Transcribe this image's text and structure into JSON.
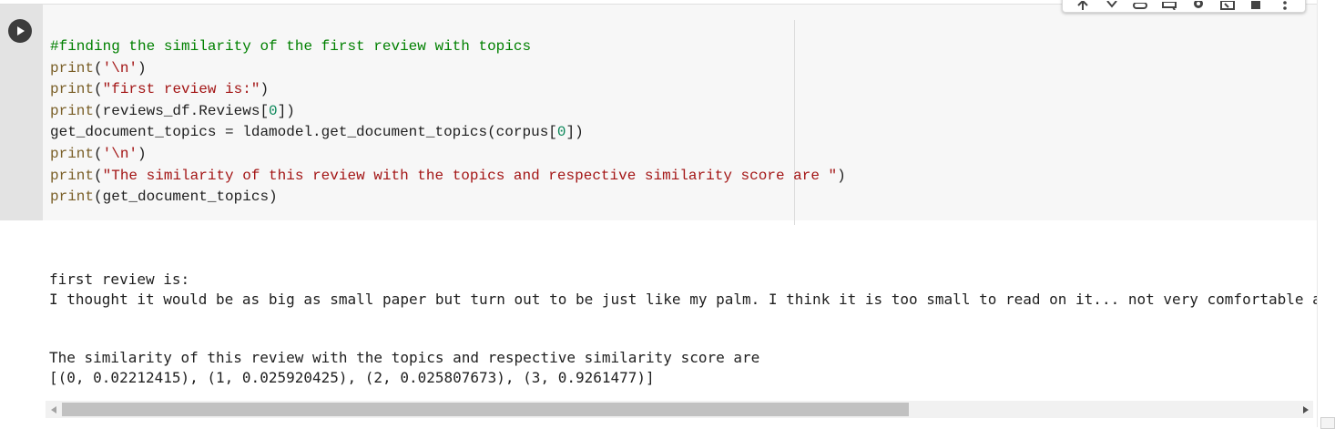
{
  "code_lines": [
    {
      "parts": [
        {
          "t": "#finding the similarity of the first review with topics",
          "c": "cm"
        }
      ]
    },
    {
      "parts": [
        {
          "t": "print",
          "c": "kw"
        },
        {
          "t": "(",
          "c": ""
        },
        {
          "t": "'\\n'",
          "c": "st"
        },
        {
          "t": ")",
          "c": ""
        }
      ]
    },
    {
      "parts": [
        {
          "t": "print",
          "c": "kw"
        },
        {
          "t": "(",
          "c": ""
        },
        {
          "t": "\"first review is:\"",
          "c": "st"
        },
        {
          "t": ")",
          "c": ""
        }
      ]
    },
    {
      "parts": [
        {
          "t": "print",
          "c": "kw"
        },
        {
          "t": "(reviews_df.Reviews[",
          "c": ""
        },
        {
          "t": "0",
          "c": "nm"
        },
        {
          "t": "])",
          "c": ""
        }
      ]
    },
    {
      "parts": [
        {
          "t": "get_document_topics = ldamodel.get_document_topics(corpus[",
          "c": ""
        },
        {
          "t": "0",
          "c": "nm"
        },
        {
          "t": "])",
          "c": ""
        }
      ]
    },
    {
      "parts": [
        {
          "t": "print",
          "c": "kw"
        },
        {
          "t": "(",
          "c": ""
        },
        {
          "t": "'\\n'",
          "c": "st"
        },
        {
          "t": ")",
          "c": ""
        }
      ]
    },
    {
      "parts": [
        {
          "t": "print",
          "c": "kw"
        },
        {
          "t": "(",
          "c": ""
        },
        {
          "t": "\"The similarity of this review with the topics and respective similarity score are \"",
          "c": "st"
        },
        {
          "t": ")",
          "c": ""
        }
      ]
    },
    {
      "parts": [
        {
          "t": "print",
          "c": "kw"
        },
        {
          "t": "(get_document_topics)",
          "c": ""
        }
      ]
    }
  ],
  "output": {
    "line1": "first review is:",
    "line2": "I thought it would be as big as small paper but turn out to be just like my palm. I think it is too small to read on it... not very comfortable as regular paper book.",
    "line3": "The similarity of this review with the topics and respective similarity score are",
    "line4": "[(0, 0.02212415), (1, 0.025920425), (2, 0.025807673), (3, 0.9261477)]"
  },
  "toolbar_icons": [
    "arrow-up-icon",
    "arrow-down-icon",
    "link-icon",
    "comment-icon",
    "gear-icon",
    "mirror-cell-icon",
    "delete-icon",
    "more-vert-icon"
  ],
  "colors": {
    "comment": "#008000",
    "keyword": "#795e26",
    "string": "#a31515",
    "number": "#098658"
  }
}
